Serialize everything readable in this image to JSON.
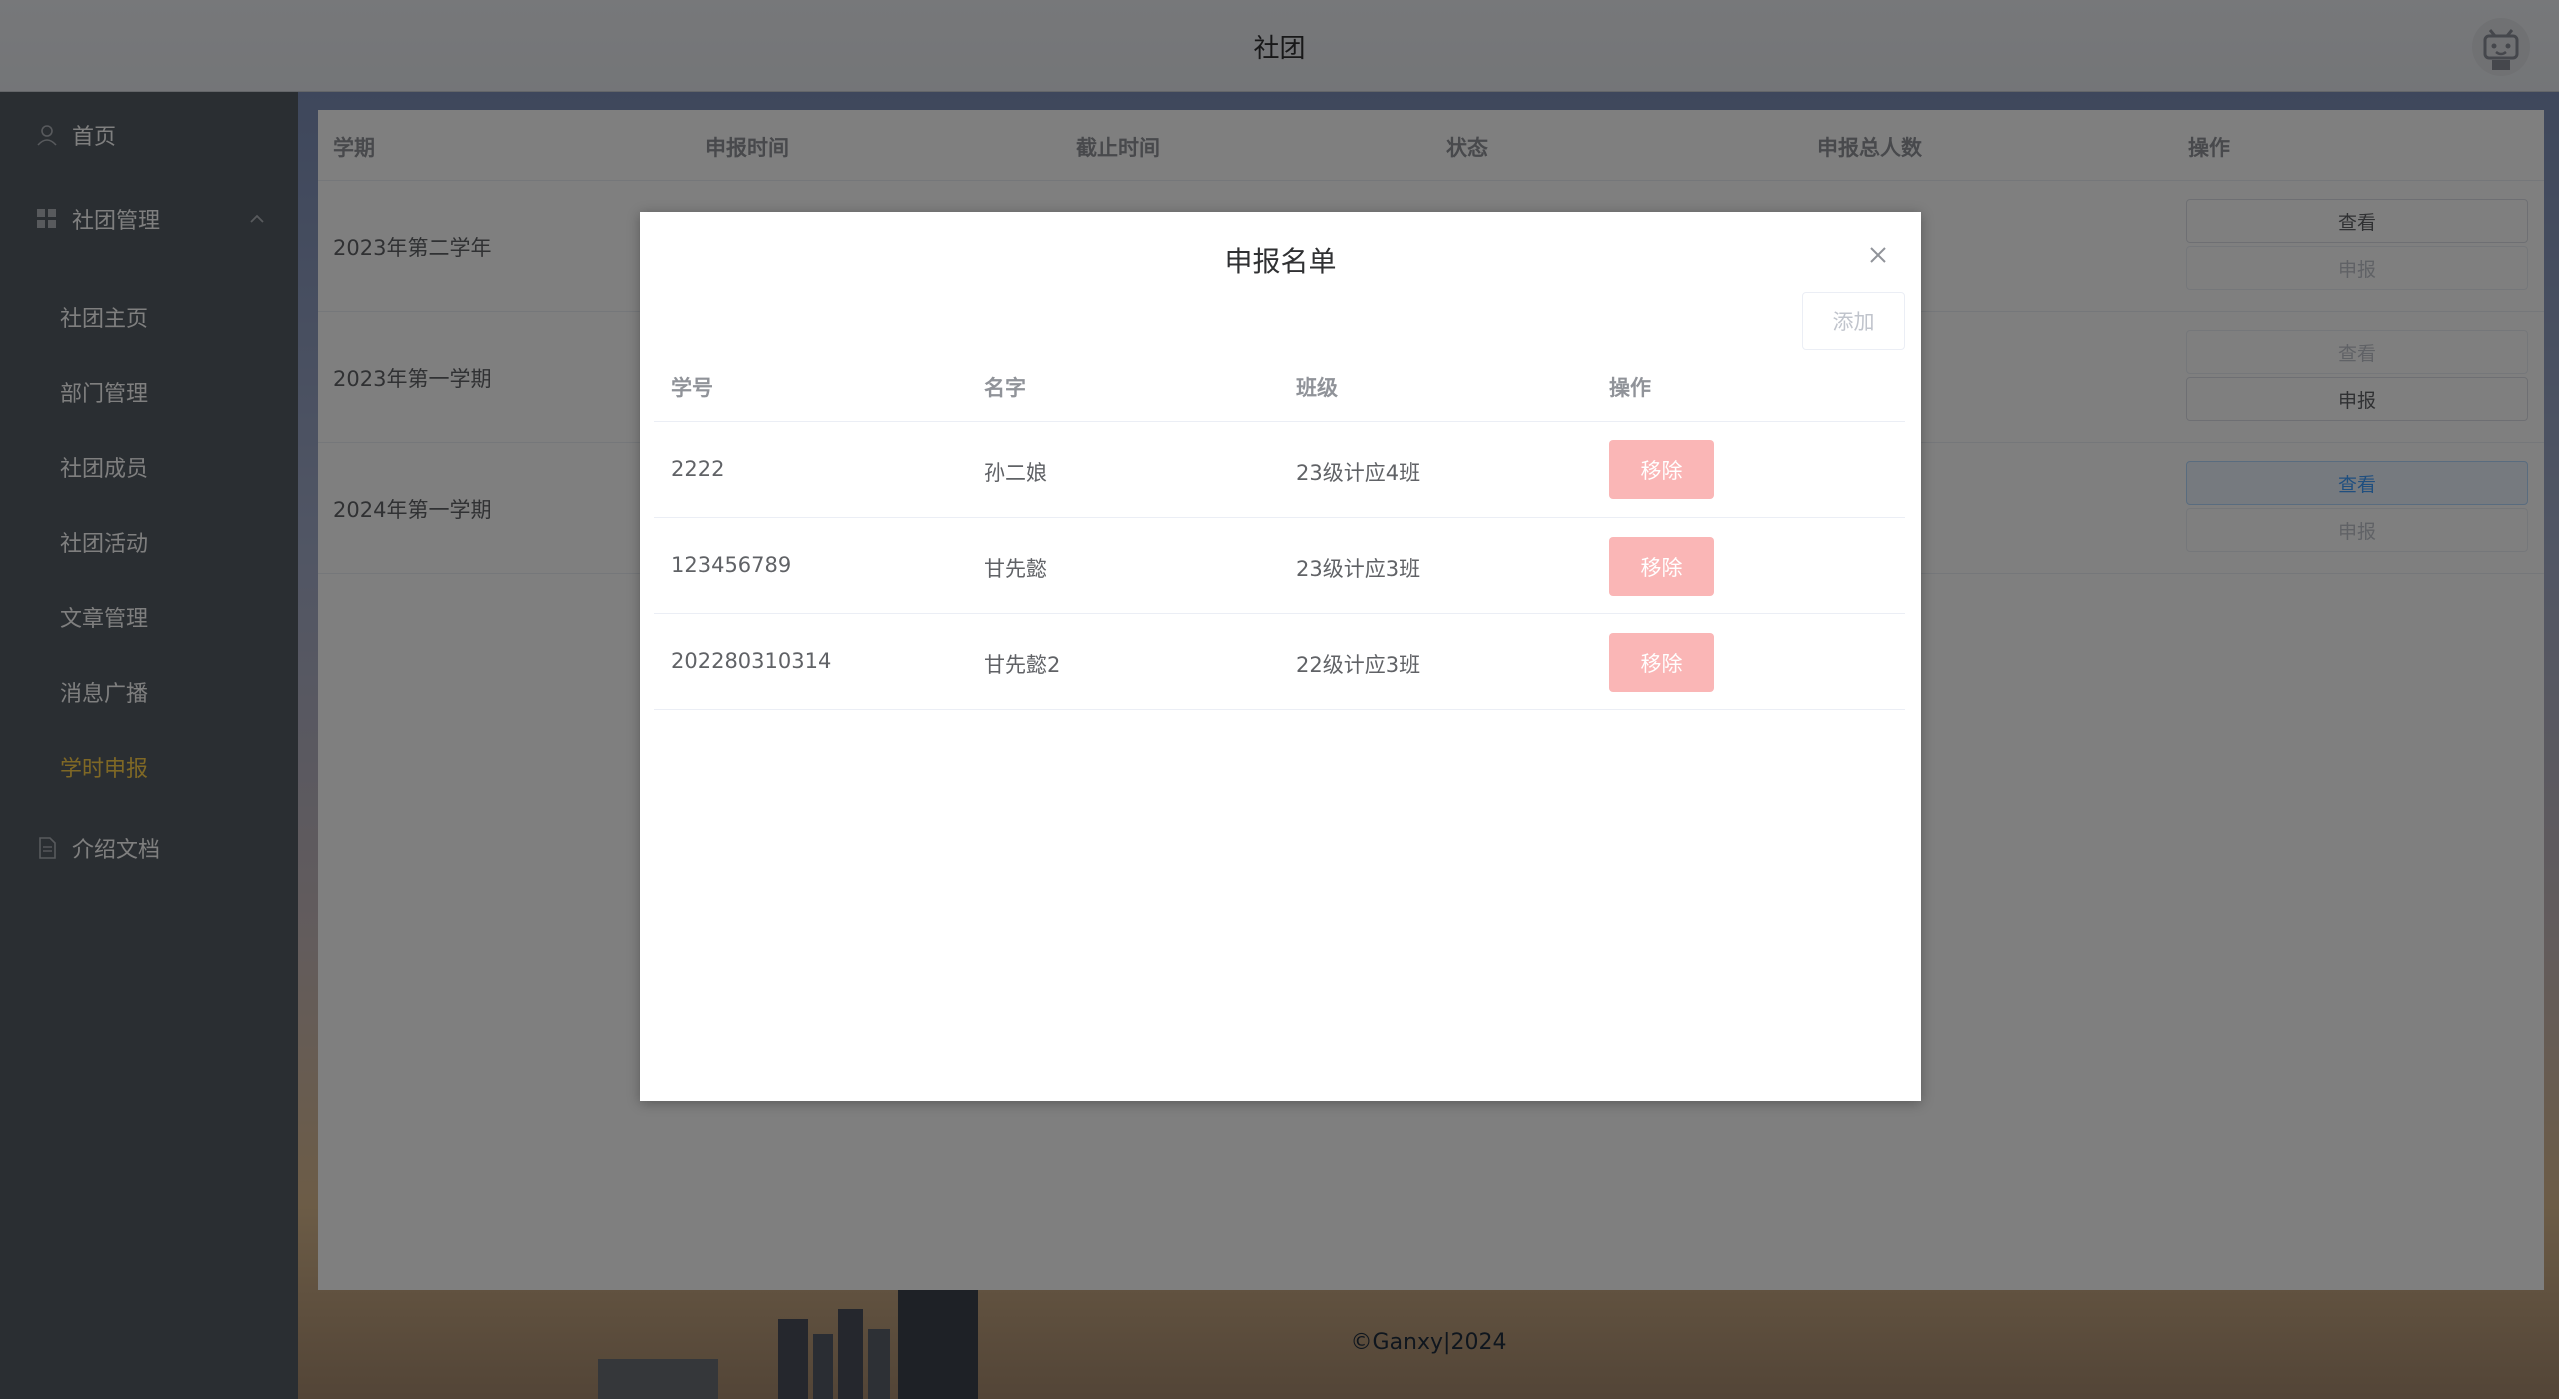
{
  "header": {
    "title": "社团"
  },
  "sidebar": {
    "home": "首页",
    "club_mgmt": "社团管理",
    "items": [
      "社团主页",
      "部门管理",
      "社团成员",
      "社团活动",
      "文章管理",
      "消息广播",
      "学时申报"
    ],
    "intro_doc": "介绍文档",
    "active_color": "#ffd04b"
  },
  "table": {
    "headers": [
      "学期",
      "申报时间",
      "截止时间",
      "状态",
      "申报总人数",
      "操作"
    ],
    "rows": [
      {
        "term": "2023年第二学年",
        "view": "查看",
        "report": "申报"
      },
      {
        "term": "2023年第一学期",
        "view": "查看",
        "report": "申报"
      },
      {
        "term": "2024年第一学期",
        "view": "查看",
        "report": "申报"
      }
    ]
  },
  "footer": "©Ganxy|2024",
  "dialog": {
    "title": "申报名单",
    "add_label": "添加",
    "headers": [
      "学号",
      "名字",
      "班级",
      "操作"
    ],
    "rows": [
      {
        "id": "2222",
        "name": "孙二娘",
        "class": "23级计应4班",
        "action": "移除"
      },
      {
        "id": "123456789",
        "name": "甘先懿",
        "class": "23级计应3班",
        "action": "移除"
      },
      {
        "id": "202280310314",
        "name": "甘先懿2",
        "class": "22级计应3班",
        "action": "移除"
      }
    ]
  },
  "colors": {
    "danger_plain": "#fab6b6",
    "primary": "#409eff"
  }
}
